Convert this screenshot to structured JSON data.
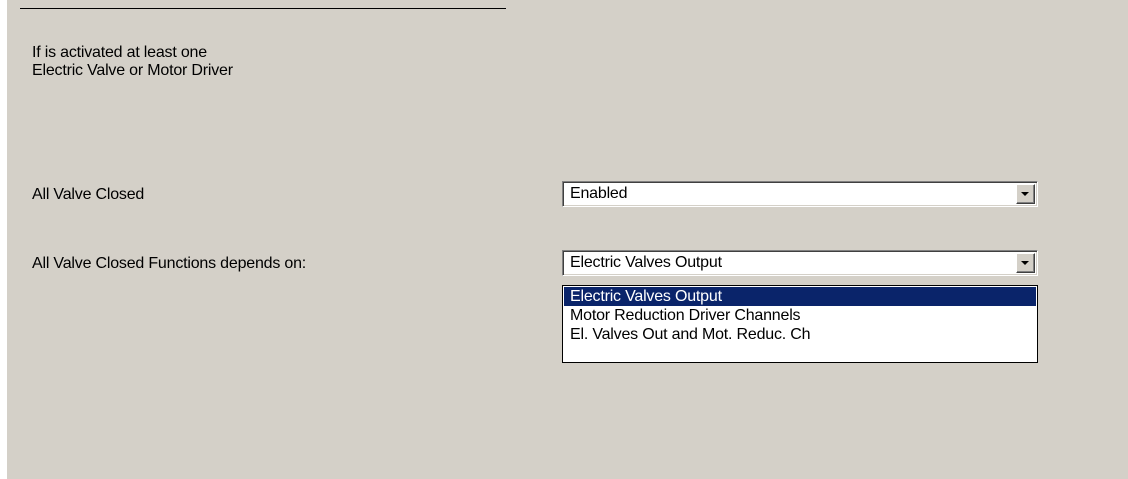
{
  "info": {
    "line1": "If is activated at least one",
    "line2": "Electric Valve or Motor Driver"
  },
  "all_valve_closed": {
    "label": "All Valve Closed",
    "value": "Enabled"
  },
  "depends_on": {
    "label": "All Valve Closed Functions depends on:",
    "value": "Electric Valves Output",
    "dropdown_open": true,
    "options": [
      {
        "label": "Electric Valves Output",
        "selected": true
      },
      {
        "label": "Motor Reduction Driver Channels",
        "selected": false
      },
      {
        "label": "El. Valves Out and Mot. Reduc. Ch",
        "selected": false
      }
    ]
  },
  "colors": {
    "panel_background": "#d4d0c8",
    "selection_background": "#0a246a",
    "selection_text": "#ffffff"
  },
  "icons": {
    "dropdown_arrow": "chevron-down-icon"
  }
}
